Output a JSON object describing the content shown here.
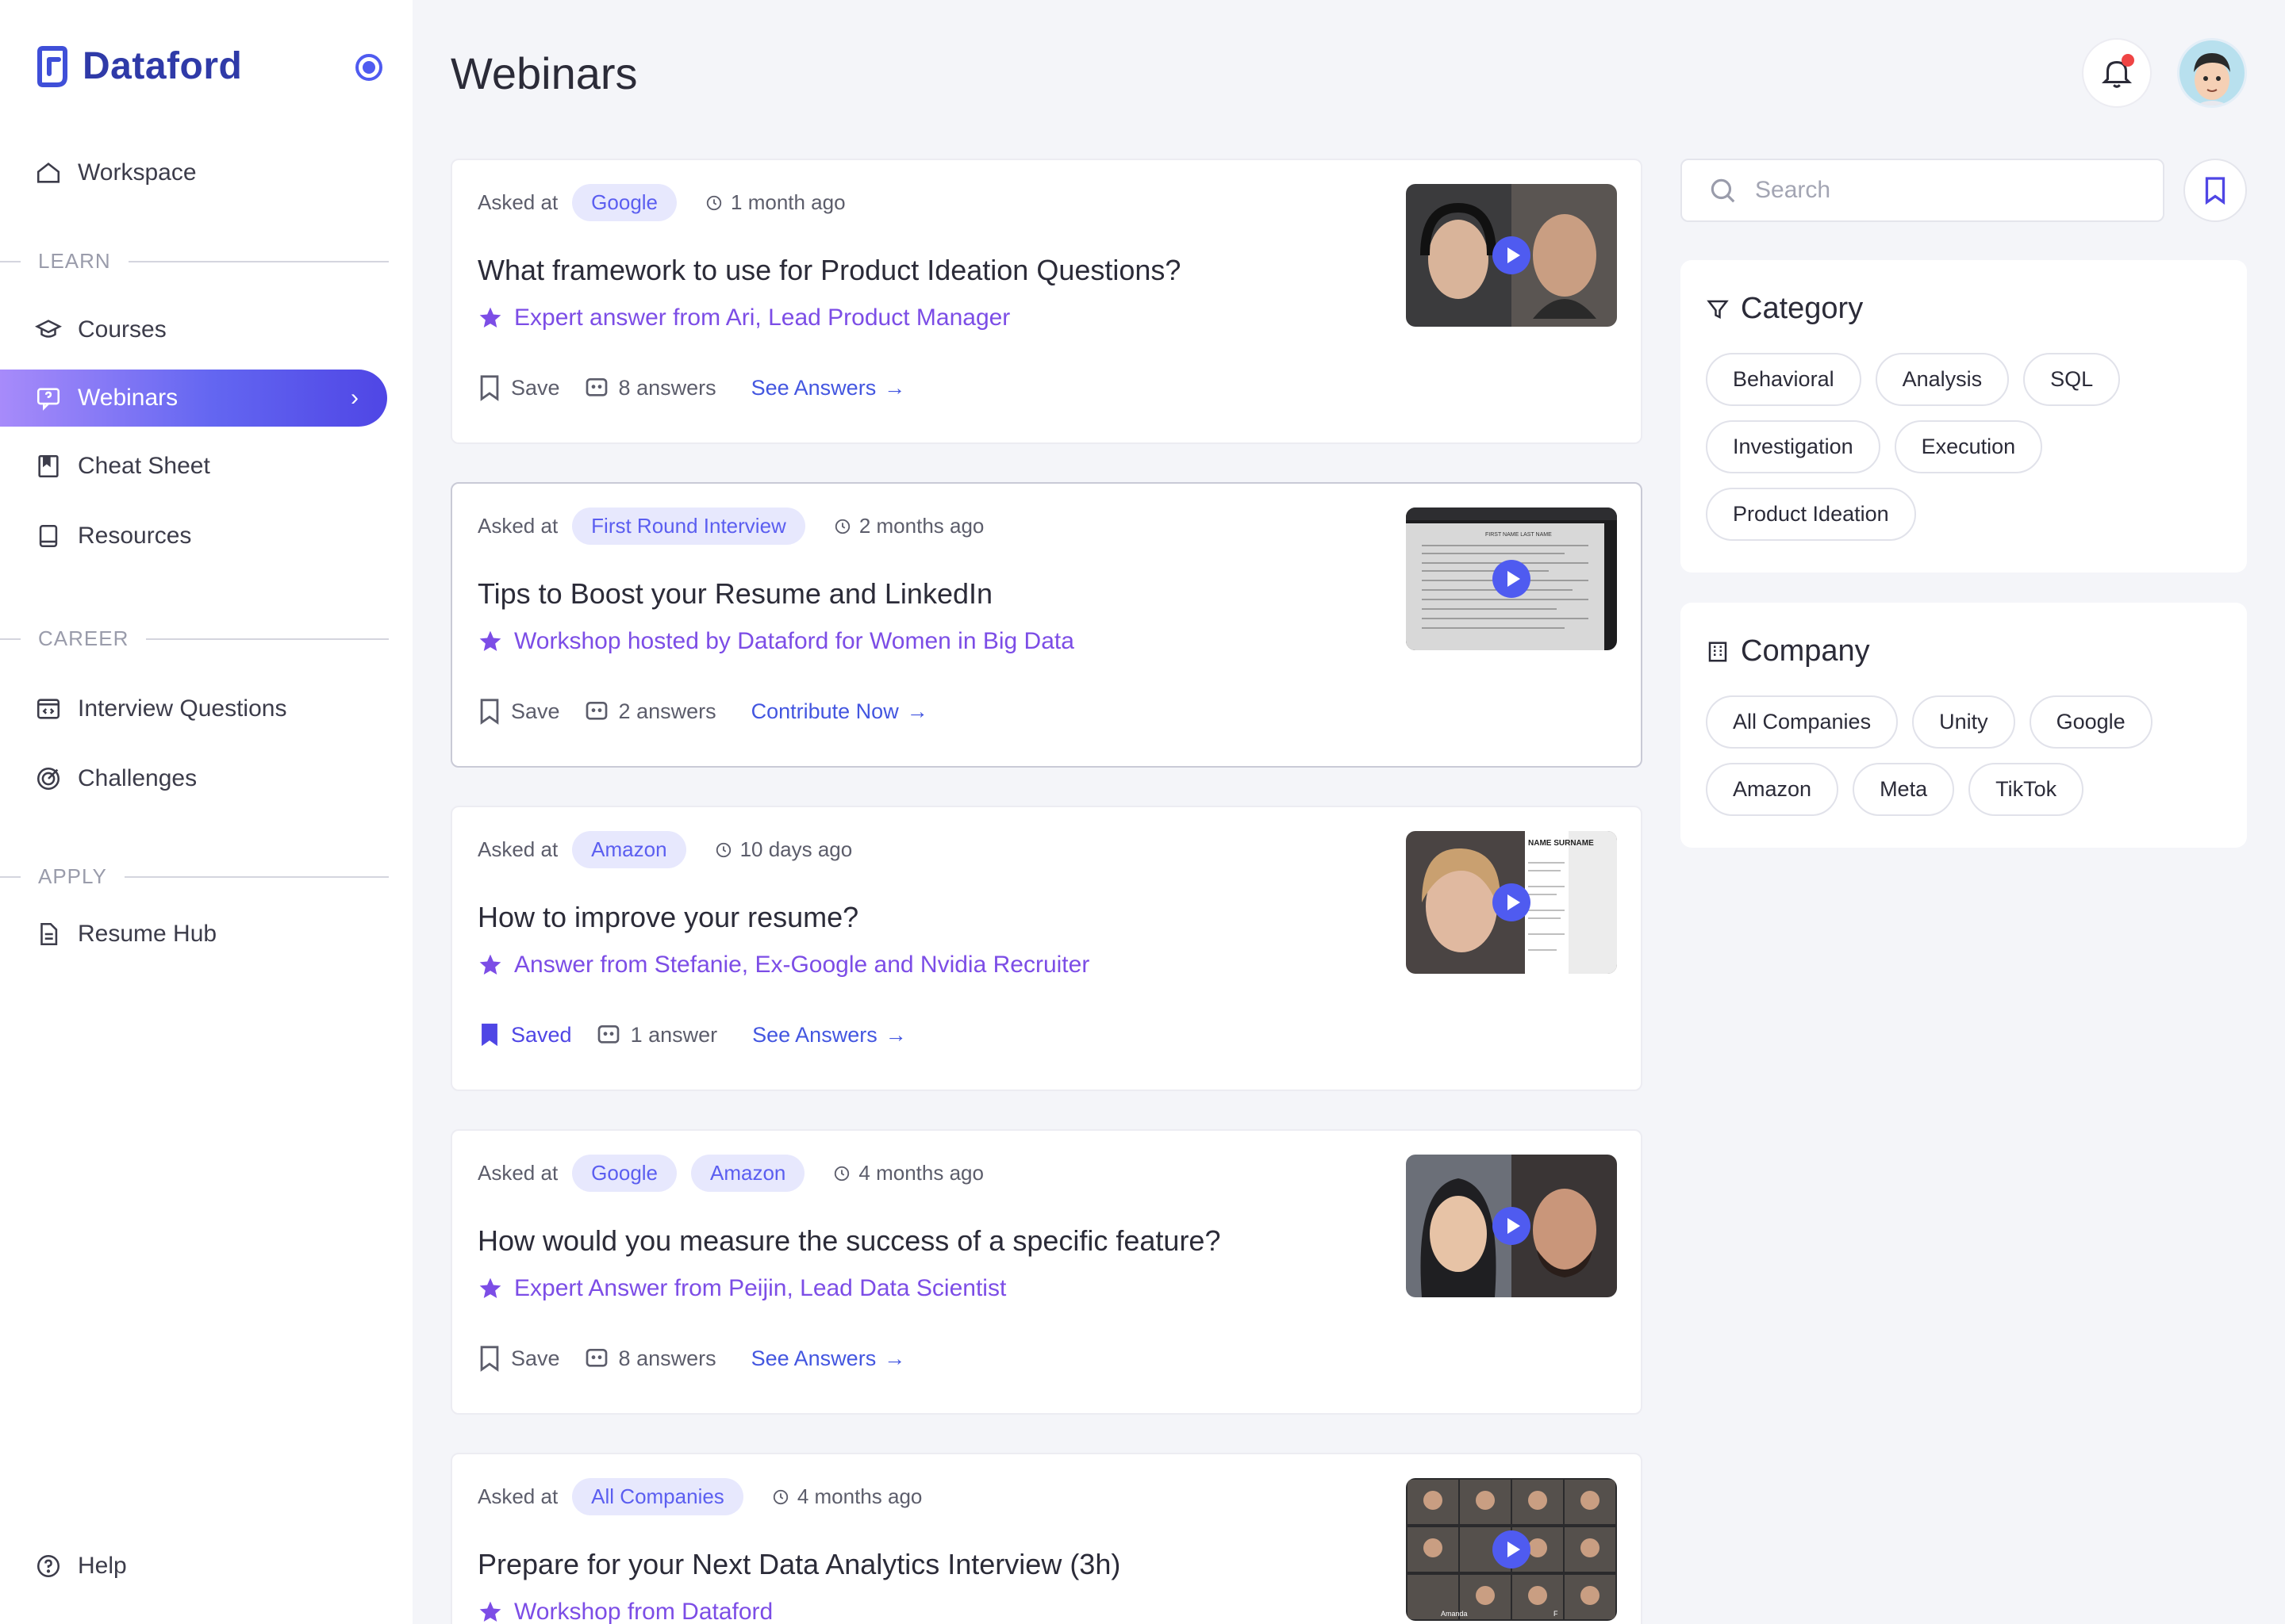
{
  "brand": {
    "name": "Dataford"
  },
  "sidebar": {
    "items": [
      {
        "label": "Workspace",
        "icon": "home-icon"
      },
      {
        "label": "Courses",
        "icon": "graduation-cap-icon"
      },
      {
        "label": "Webinars",
        "icon": "chat-question-icon"
      },
      {
        "label": "Cheat Sheet",
        "icon": "bookmark-book-icon"
      },
      {
        "label": "Resources",
        "icon": "book-icon"
      },
      {
        "label": "Interview Questions",
        "icon": "code-window-icon"
      },
      {
        "label": "Challenges",
        "icon": "target-icon"
      },
      {
        "label": "Resume Hub",
        "icon": "document-icon"
      }
    ],
    "sections": {
      "learn": "LEARN",
      "career": "CAREER",
      "apply": "APPLY"
    },
    "help": "Help"
  },
  "header": {
    "title": "Webinars"
  },
  "search": {
    "placeholder": "Search"
  },
  "cards": [
    {
      "asked_at": "Asked at",
      "tags": [
        "Google"
      ],
      "time": "1 month ago",
      "title": "What framework to use for Product Ideation Questions?",
      "expert": "Expert answer from Ari, Lead Product Manager",
      "save": "Save",
      "answers": "8 answers",
      "link": "See Answers"
    },
    {
      "asked_at": "Asked at",
      "tags": [
        "First Round Interview"
      ],
      "time": "2 months ago",
      "title": "Tips to Boost your Resume and LinkedIn",
      "expert": "Workshop hosted by Dataford for Women in Big Data",
      "save": "Save",
      "answers": "2 answers",
      "link": "Contribute Now"
    },
    {
      "asked_at": "Asked at",
      "tags": [
        "Amazon"
      ],
      "time": "10 days ago",
      "title": "How to improve your resume?",
      "expert": "Answer from Stefanie, Ex-Google and Nvidia Recruiter",
      "save": "Saved",
      "answers": "1 answer",
      "link": "See Answers"
    },
    {
      "asked_at": "Asked at",
      "tags": [
        "Google",
        "Amazon"
      ],
      "time": "4 months ago",
      "title": "How would you measure the success of a specific feature?",
      "expert": "Expert Answer from Peijin, Lead Data Scientist",
      "save": "Save",
      "answers": "8 answers",
      "link": "See Answers"
    },
    {
      "asked_at": "Asked at",
      "tags": [
        "All Companies"
      ],
      "time": "4 months ago",
      "title": "Prepare for your Next Data Analytics Interview (3h)",
      "expert": "Workshop from Dataford"
    }
  ],
  "thumb_text": {
    "resume_header": "FIRST NAME LAST NAME",
    "resume_name": "NAME SURNAME",
    "participant": "Amanda",
    "participant_initial": "F"
  },
  "category": {
    "title": "Category",
    "items": [
      "Behavioral",
      "Analysis",
      "SQL",
      "Investigation",
      "Execution",
      "Product Ideation"
    ]
  },
  "company": {
    "title": "Company",
    "items": [
      "All Companies",
      "Unity",
      "Google",
      "Amazon",
      "Meta",
      "TikTok"
    ]
  },
  "colors": {
    "accent": "#4f5bf0",
    "brand": "#2f3aa8",
    "expert": "#7c4de6",
    "chip_bg": "#e7e8fd"
  }
}
